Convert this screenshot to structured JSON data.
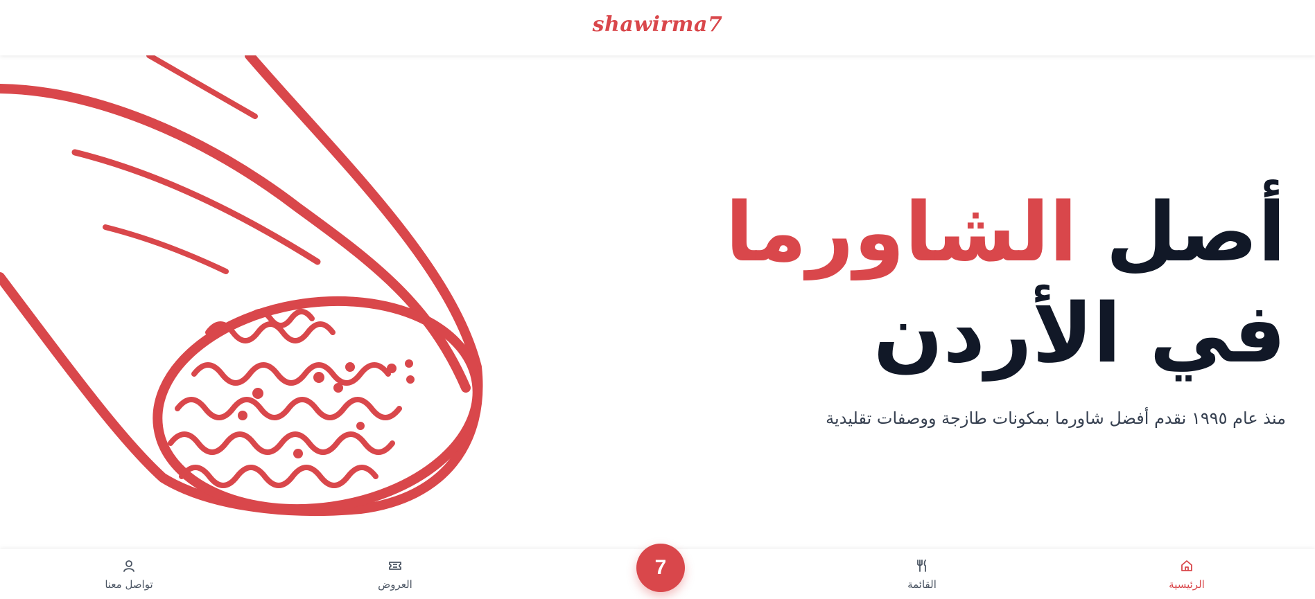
{
  "header": {
    "brand": "shawirma7"
  },
  "hero": {
    "title_part1": "أصل",
    "title_highlight": "الشاورما",
    "title_part2": "في الأردن",
    "subtitle": "منذ عام ١٩٩٥ نقدم أفضل شاورما بمكونات طازجة ووصفات تقليدية"
  },
  "bottom_nav": {
    "home_label": "الرئيسية",
    "menu_label": "القائمة",
    "center_label": "7",
    "offers_label": "العروض",
    "contact_label": "تواصل معنا"
  },
  "colors": {
    "accent": "#d9474b",
    "text": "#111827",
    "muted": "#4b5563"
  },
  "icons": {
    "home": "home-icon",
    "menu": "utensils-icon",
    "offers": "ticket-icon",
    "contact": "user-icon"
  }
}
